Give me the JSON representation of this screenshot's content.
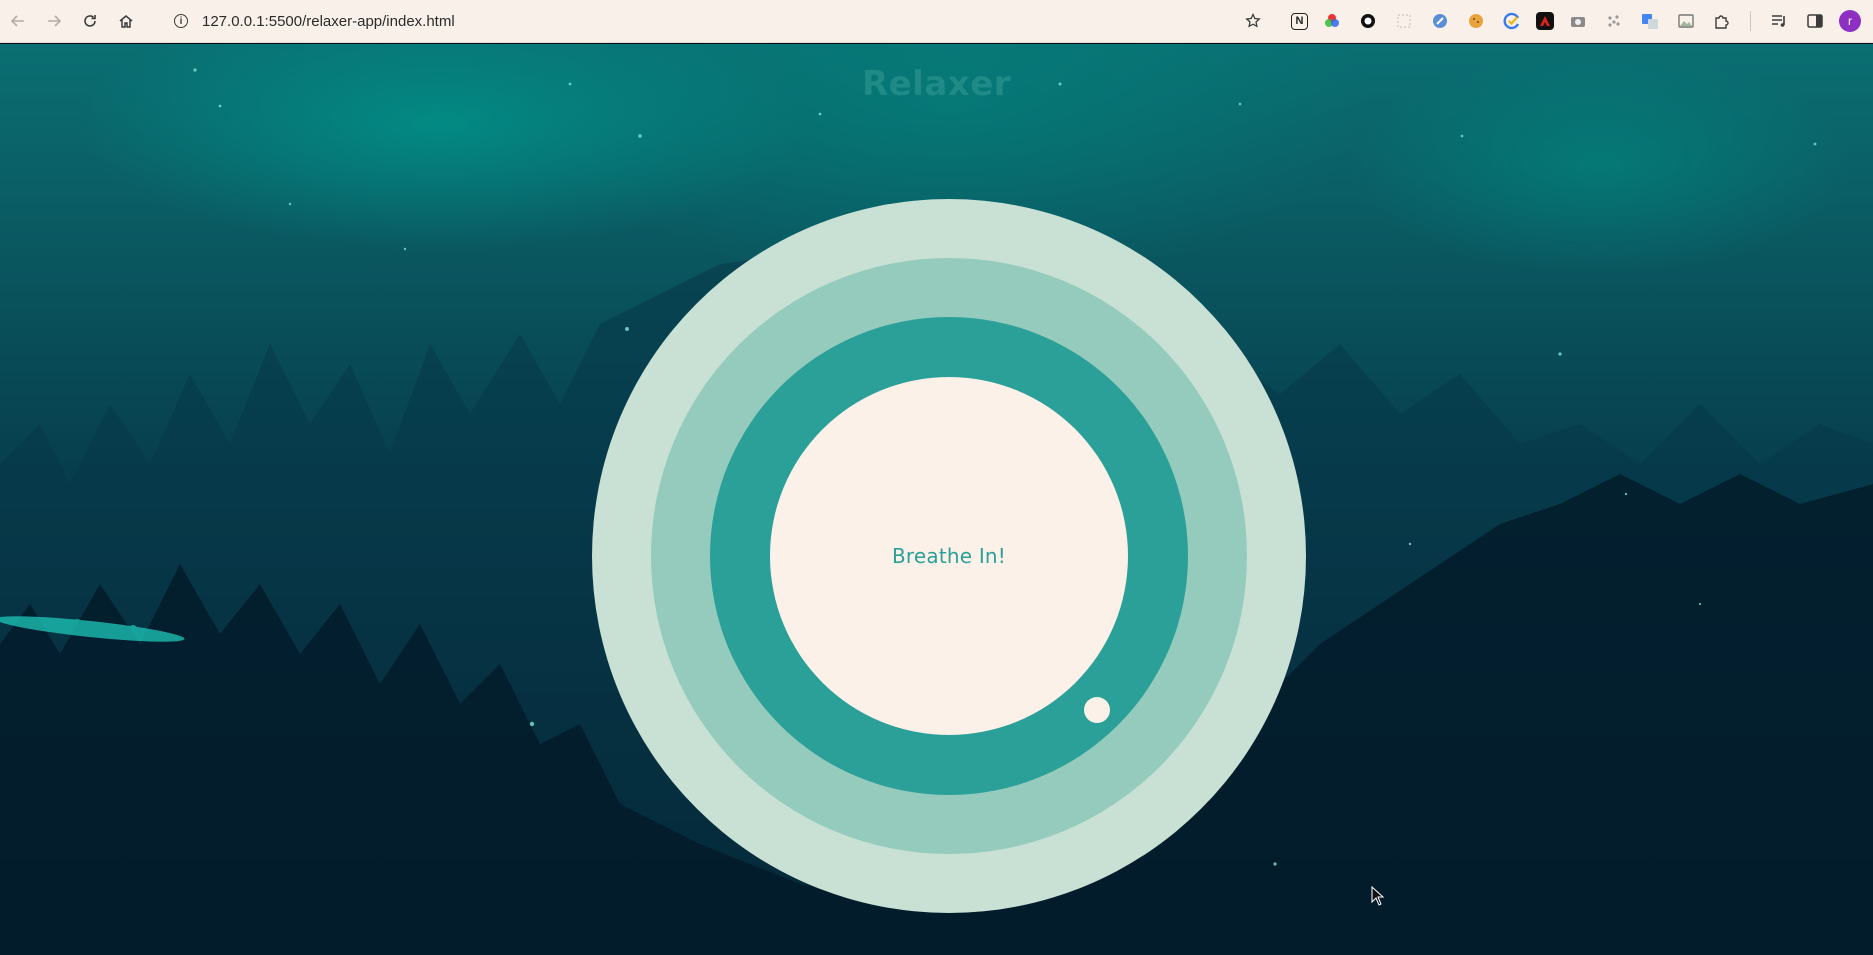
{
  "browser": {
    "url": "127.0.0.1:5500/relaxer-app/index.html",
    "back_icon": "arrow-left-icon",
    "forward_icon": "arrow-right-icon",
    "reload_icon": "reload-icon",
    "home_icon": "home-icon",
    "profile_initial": "r",
    "extensions": [
      "notion-extension-icon",
      "color-picker-extension-icon",
      "record-extension-icon",
      "screenshot-extension-icon",
      "sparkle-extension-icon",
      "cookie-extension-icon",
      "grammar-extension-icon",
      "adobe-extension-icon",
      "camera-extension-icon",
      "dots-extension-icon",
      "translate-extension-icon",
      "image-extension-icon",
      "puzzle-extensions-icon"
    ]
  },
  "app": {
    "title": "Relaxer",
    "breathe_text": "Breathe In!"
  },
  "colors": {
    "ring_outer": "#c9e0d4",
    "ring_middle": "#94cbbd",
    "ring_inner": "#2ba098",
    "ring_core": "#fbf1e9",
    "title": "#1f8a86",
    "text_accent": "#2ba098"
  }
}
